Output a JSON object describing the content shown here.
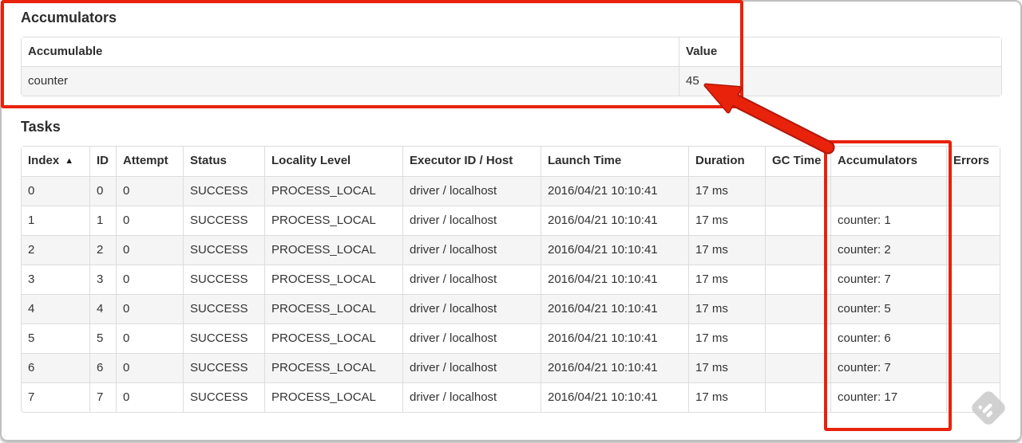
{
  "accumulators_section": {
    "title": "Accumulators",
    "table": {
      "headers": [
        "Accumulable",
        "Value"
      ],
      "rows": [
        [
          "counter",
          "45"
        ]
      ]
    }
  },
  "tasks_section": {
    "title": "Tasks",
    "table": {
      "headers": [
        "Index",
        "ID",
        "Attempt",
        "Status",
        "Locality Level",
        "Executor ID / Host",
        "Launch Time",
        "Duration",
        "GC Time",
        "Accumulators",
        "Errors"
      ],
      "sort_icon": "▲",
      "sorted_column": "Index",
      "rows": [
        [
          "0",
          "0",
          "0",
          "SUCCESS",
          "PROCESS_LOCAL",
          "driver / localhost",
          "2016/04/21 10:10:41",
          "17 ms",
          "",
          "",
          ""
        ],
        [
          "1",
          "1",
          "0",
          "SUCCESS",
          "PROCESS_LOCAL",
          "driver / localhost",
          "2016/04/21 10:10:41",
          "17 ms",
          "",
          "counter: 1",
          ""
        ],
        [
          "2",
          "2",
          "0",
          "SUCCESS",
          "PROCESS_LOCAL",
          "driver / localhost",
          "2016/04/21 10:10:41",
          "17 ms",
          "",
          "counter: 2",
          ""
        ],
        [
          "3",
          "3",
          "0",
          "SUCCESS",
          "PROCESS_LOCAL",
          "driver / localhost",
          "2016/04/21 10:10:41",
          "17 ms",
          "",
          "counter: 7",
          ""
        ],
        [
          "4",
          "4",
          "0",
          "SUCCESS",
          "PROCESS_LOCAL",
          "driver / localhost",
          "2016/04/21 10:10:41",
          "17 ms",
          "",
          "counter: 5",
          ""
        ],
        [
          "5",
          "5",
          "0",
          "SUCCESS",
          "PROCESS_LOCAL",
          "driver / localhost",
          "2016/04/21 10:10:41",
          "17 ms",
          "",
          "counter: 6",
          ""
        ],
        [
          "6",
          "6",
          "0",
          "SUCCESS",
          "PROCESS_LOCAL",
          "driver / localhost",
          "2016/04/21 10:10:41",
          "17 ms",
          "",
          "counter: 7",
          ""
        ],
        [
          "7",
          "7",
          "0",
          "SUCCESS",
          "PROCESS_LOCAL",
          "driver / localhost",
          "2016/04/21 10:10:41",
          "17 ms",
          "",
          "counter: 17",
          ""
        ]
      ]
    }
  },
  "annotations": {
    "highlight_color": "#e8220b",
    "highlight_edge_color": "#b2170b"
  }
}
